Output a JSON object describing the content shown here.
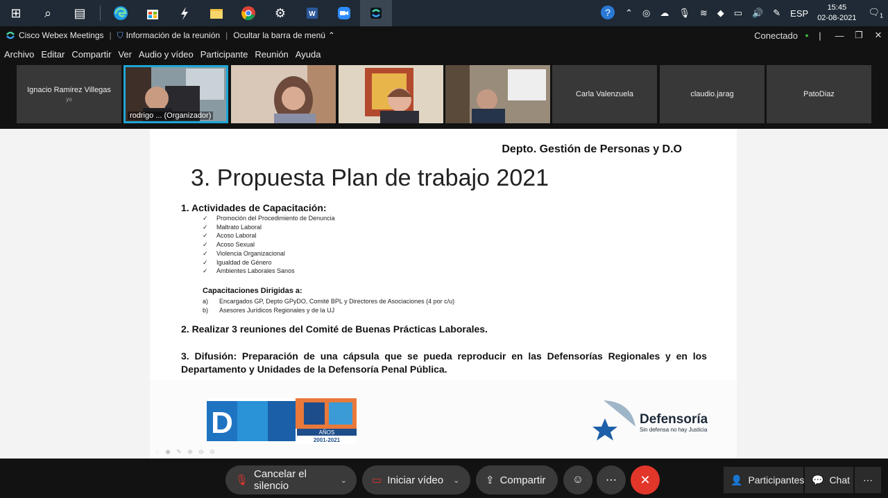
{
  "taskbar": {
    "apps": [
      "start-icon",
      "search-icon",
      "task-view-icon",
      "edge-icon",
      "store-icon",
      "winamp-icon",
      "explorer-icon",
      "chrome-icon",
      "settings-icon",
      "word-icon",
      "zoom-icon",
      "webex-icon"
    ],
    "tray": {
      "lang": "ESP",
      "time": "15:45",
      "date": "02-08-2021",
      "notifications": "1"
    }
  },
  "titlebar": {
    "app": "Cisco Webex Meetings",
    "info": "Información de la reunión",
    "hide_menu": "Ocultar la barra de menú",
    "status": "Conectado"
  },
  "menubar": [
    "Archivo",
    "Editar",
    "Compartir",
    "Ver",
    "Audio y vídeo",
    "Participante",
    "Reunión",
    "Ayuda"
  ],
  "participants": [
    {
      "name": "Ignacio Ramirez Villegas",
      "sub": "yo"
    },
    {
      "caption": "rodrigo ...  (Organizador)"
    },
    {
      "caption": ""
    },
    {
      "caption": ""
    },
    {
      "caption": ""
    },
    {
      "name": "Carla Valenzuela"
    },
    {
      "name": "claudio.jarag"
    },
    {
      "name": "PatoDiaz"
    }
  ],
  "slide": {
    "dept": "Depto. Gestión de Personas y D.O",
    "title": "3.  Propuesta Plan de trabajo 2021",
    "section1": "1.   Actividades de Capacitación:",
    "activities": [
      "Promoción del Procedimiento de Denuncia",
      "Maltrato Laboral",
      "Acoso Laboral",
      "Acoso Sexual",
      "Violencia Organizacional",
      "Igualdad de Género",
      "Ambientes Laborales  Sanos"
    ],
    "cap_title": "Capacitaciones Dirigidas a:",
    "targets": [
      {
        "letter": "a)",
        "text": "Encargados GP, Depto GPyDO, Comité BPL y Directores de Asociaciones (4 por c/u)"
      },
      {
        "letter": "b)",
        "text": "Asesores Jurídicos Regionales y de la UJ"
      }
    ],
    "point2": "2. Realizar 3 reuniones del Comité de Buenas Prácticas Laborales.",
    "point3": "3. Difusión: Preparación de una cápsula que se pueda reproducir en las Defensorías Regionales y en los Departamento y Unidades de la Defensoría Penal Pública.",
    "logo_dpp": {
      "letters": "DPP20",
      "anos": "AÑOS",
      "years": "2001-2021"
    },
    "logo_def": {
      "name": "Defensoría",
      "tagline": "Sin defensa no hay Justicia"
    }
  },
  "controls": {
    "mute": "Cancelar el silencio",
    "video": "Iniciar vídeo",
    "share": "Compartir",
    "participants": "Participantes",
    "chat": "Chat"
  },
  "colors": {
    "accent": "#1fa6d6",
    "end_call": "#e2362a",
    "connected": "#3fbf3f"
  }
}
